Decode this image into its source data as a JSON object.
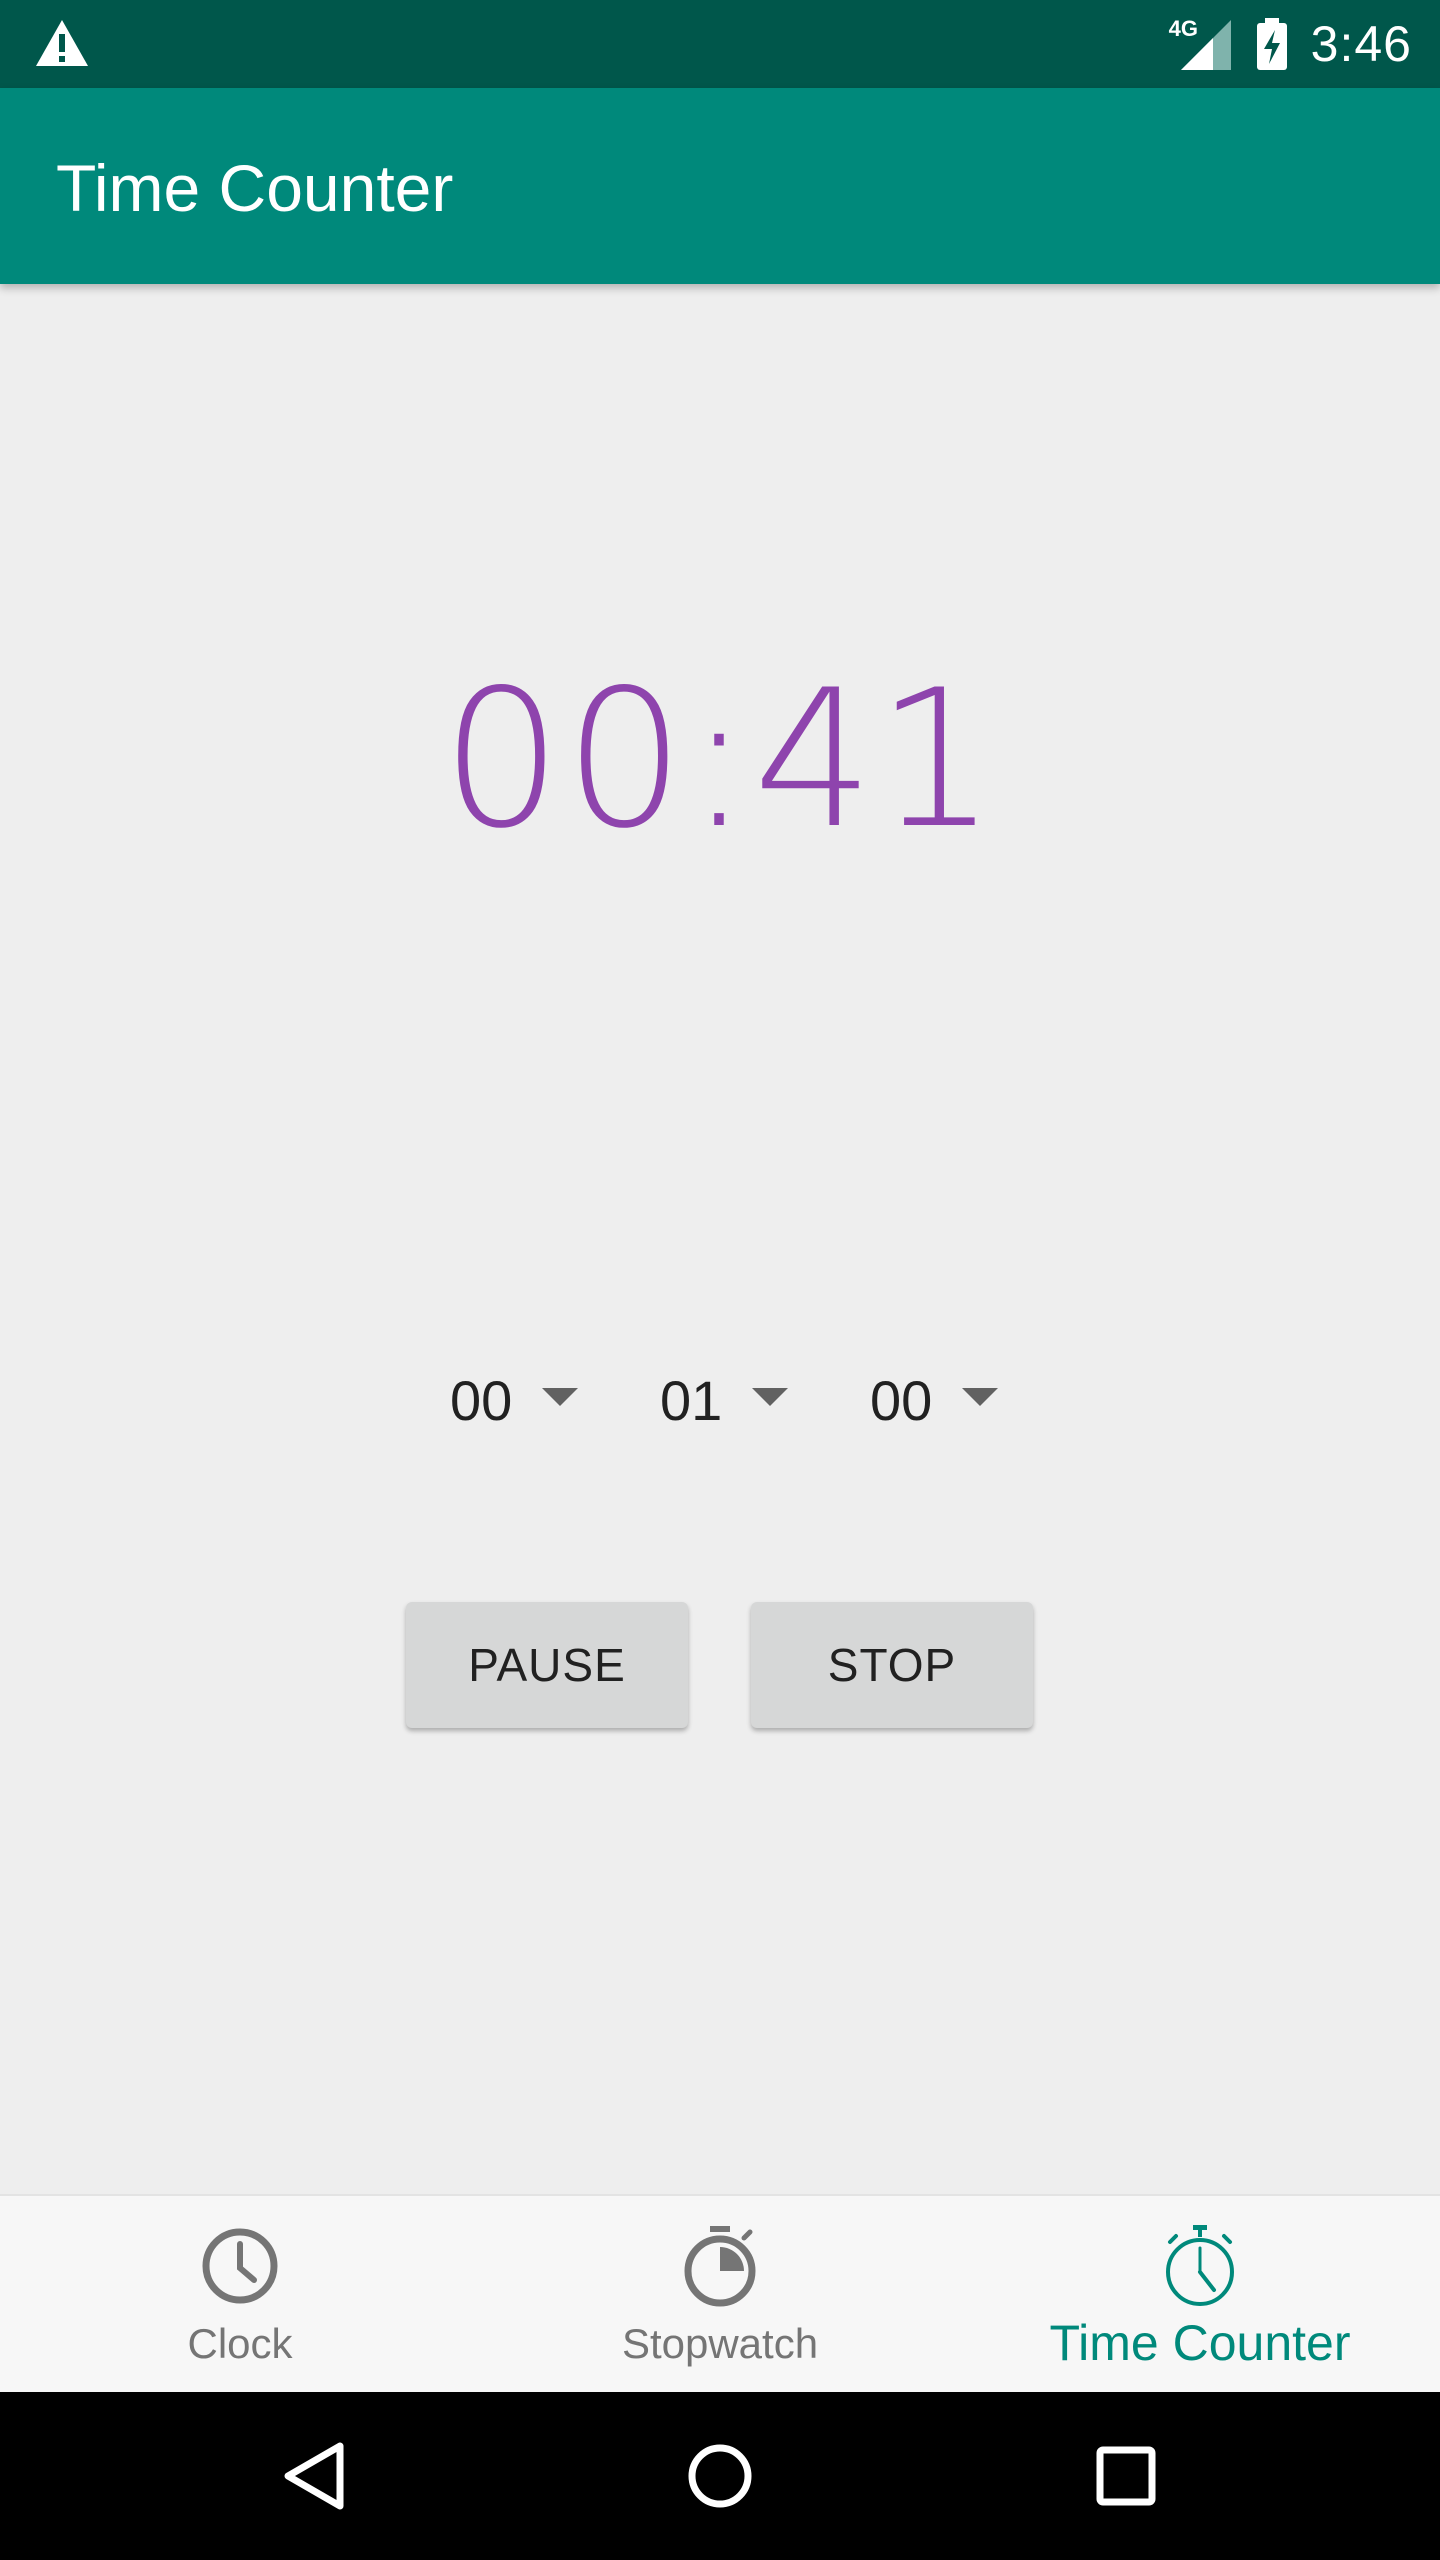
{
  "status_bar": {
    "time": "3:46",
    "network_label": "4G",
    "icons": [
      "warning-icon",
      "signal-4g-icon",
      "battery-charging-icon"
    ]
  },
  "app_bar": {
    "title": "Time Counter"
  },
  "timer": {
    "display": "00:41",
    "color": "#8e44ad"
  },
  "spinners": [
    {
      "value": "00",
      "icon": "dropdown-caret-icon"
    },
    {
      "value": "01",
      "icon": "dropdown-caret-icon"
    },
    {
      "value": "00",
      "icon": "dropdown-caret-icon"
    }
  ],
  "buttons": {
    "pause_label": "PAUSE",
    "stop_label": "STOP"
  },
  "bottom_nav": {
    "items": [
      {
        "label": "Clock",
        "icon": "clock-icon",
        "active": false
      },
      {
        "label": "Stopwatch",
        "icon": "stopwatch-icon",
        "active": false
      },
      {
        "label": "Time Counter",
        "icon": "timer-icon",
        "active": true
      }
    ],
    "active_color": "#00897b",
    "inactive_color": "#757575"
  },
  "system_nav": {
    "icons": [
      "back-icon",
      "home-icon",
      "recents-icon"
    ]
  },
  "colors": {
    "status_bar": "#00574b",
    "app_bar": "#00897b",
    "background": "#eeeeee",
    "button": "#d6d7d7"
  }
}
